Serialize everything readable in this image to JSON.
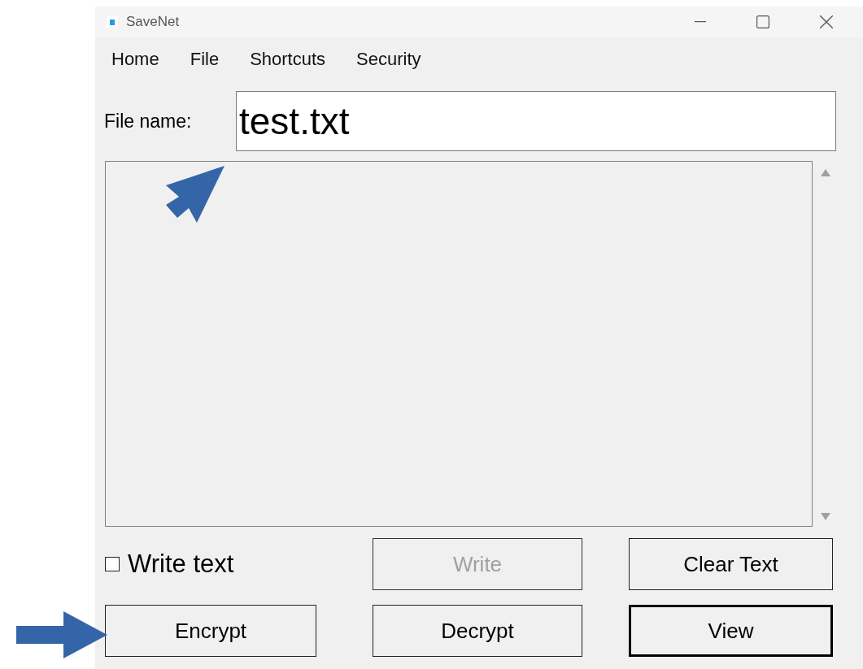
{
  "window": {
    "title": "SaveNet"
  },
  "menu": [
    "Home",
    "File",
    "Shortcuts",
    "Security"
  ],
  "file_name": {
    "label": "File name:",
    "value": "test.txt"
  },
  "write_text": {
    "label": "Write text",
    "checked": false
  },
  "buttons": [
    {
      "label": "Write",
      "disabled": true,
      "default": false
    },
    {
      "label": "Clear Text",
      "disabled": false,
      "default": false
    },
    {
      "label": "Encrypt",
      "disabled": false,
      "default": false
    },
    {
      "label": "Decrypt",
      "disabled": false,
      "default": false
    },
    {
      "label": "View",
      "disabled": false,
      "default": true
    }
  ]
}
